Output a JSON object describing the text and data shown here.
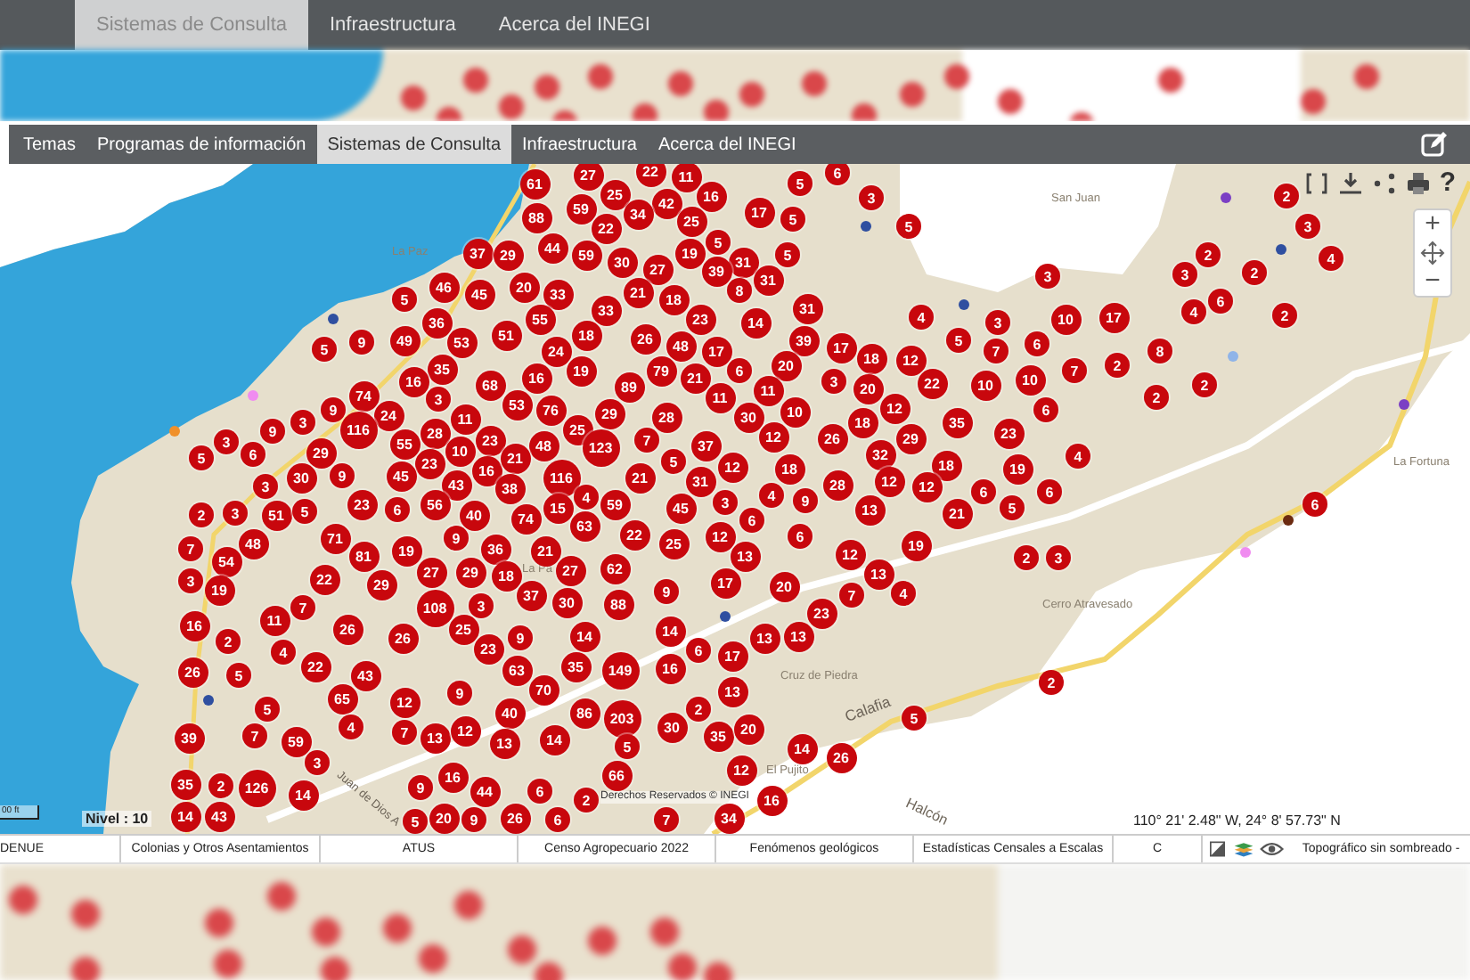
{
  "backdrop": {
    "tabs": [
      {
        "label": "Sistemas de Consulta",
        "selected": true
      },
      {
        "label": "Infraestructura",
        "selected": false
      },
      {
        "label": "Acerca del INEGI",
        "selected": false
      }
    ]
  },
  "nav": {
    "tabs": [
      {
        "label": "Temas",
        "selected": false
      },
      {
        "label": "Programas de información",
        "selected": false
      },
      {
        "label": "Sistemas de Consulta",
        "selected": true
      },
      {
        "label": "Infraestructura",
        "selected": false
      },
      {
        "label": "Acerca del INEGI",
        "selected": false
      }
    ]
  },
  "map": {
    "tools": {
      "help": "?",
      "zoom_in": "+",
      "zoom_out": "−"
    },
    "clusters": [
      "27",
      "22",
      "11",
      "6",
      "61",
      "5",
      "25",
      "42",
      "16",
      "3",
      "2",
      "88",
      "59",
      "22",
      "34",
      "25",
      "17",
      "5",
      "5",
      "3",
      "44",
      "5",
      "37",
      "29",
      "59",
      "30",
      "19",
      "31",
      "5",
      "2",
      "4",
      "27",
      "39",
      "31",
      "3",
      "3",
      "2",
      "5",
      "46",
      "45",
      "20",
      "33",
      "21",
      "18",
      "8",
      "6",
      "36",
      "55",
      "33",
      "23",
      "14",
      "31",
      "4",
      "3",
      "10",
      "17",
      "4",
      "2",
      "5",
      "9",
      "49",
      "53",
      "51",
      "24",
      "18",
      "26",
      "48",
      "17",
      "39",
      "17",
      "18",
      "12",
      "5",
      "7",
      "6",
      "8",
      "35",
      "19",
      "79",
      "6",
      "20",
      "7",
      "2",
      "16",
      "68",
      "16",
      "89",
      "21",
      "11",
      "3",
      "20",
      "22",
      "10",
      "10",
      "2",
      "74",
      "3",
      "11",
      "2",
      "3",
      "9",
      "24",
      "11",
      "53",
      "76",
      "29",
      "28",
      "30",
      "10",
      "18",
      "12",
      "35",
      "6",
      "3",
      "9",
      "116",
      "55",
      "28",
      "23",
      "48",
      "25",
      "123",
      "7",
      "37",
      "12",
      "26",
      "29",
      "23",
      "5",
      "6",
      "29",
      "23",
      "10",
      "16",
      "21",
      "5",
      "12",
      "18",
      "32",
      "18",
      "19",
      "4",
      "3",
      "30",
      "9",
      "45",
      "43",
      "38",
      "116",
      "21",
      "31",
      "28",
      "12",
      "12",
      "6",
      "6",
      "2",
      "3",
      "51",
      "5",
      "23",
      "6",
      "56",
      "40",
      "74",
      "15",
      "4",
      "59",
      "45",
      "3",
      "4",
      "6",
      "9",
      "13",
      "21",
      "5",
      "6",
      "63",
      "7",
      "48",
      "54",
      "71",
      "81",
      "19",
      "9",
      "36",
      "21",
      "22",
      "25",
      "12",
      "13",
      "6",
      "12",
      "19",
      "2",
      "3",
      "3",
      "19",
      "22",
      "29",
      "27",
      "29",
      "18",
      "37",
      "27",
      "62",
      "9",
      "17",
      "20",
      "13",
      "7",
      "4",
      "7",
      "108",
      "3",
      "30",
      "88",
      "11",
      "23",
      "16",
      "26",
      "25",
      "14",
      "2",
      "26",
      "9",
      "14",
      "13",
      "13",
      "4",
      "23",
      "6",
      "17",
      "26",
      "5",
      "22",
      "43",
      "63",
      "35",
      "149",
      "16",
      "2",
      "65",
      "12",
      "9",
      "70",
      "13",
      "5",
      "40",
      "86",
      "203",
      "2",
      "5",
      "39",
      "7",
      "59",
      "4",
      "7",
      "13",
      "12",
      "13",
      "14",
      "5",
      "30",
      "35",
      "20",
      "14",
      "3",
      "26",
      "16",
      "66",
      "12",
      "35",
      "2",
      "126",
      "14",
      "9",
      "44",
      "6",
      "2",
      "16",
      "14",
      "43",
      "5",
      "20",
      "9",
      "26",
      "6",
      "7",
      "34"
    ],
    "points": [
      {
        "color": "#2f4fa0"
      },
      {
        "color": "#2f4fa0"
      },
      {
        "color": "#2f4fa0"
      },
      {
        "color": "#2f4fa0"
      },
      {
        "color": "#7b3fc4"
      },
      {
        "color": "#7b3fc4"
      },
      {
        "color": "#8fb4e8"
      },
      {
        "color": "#f08cf0"
      },
      {
        "color": "#f0902a"
      },
      {
        "color": "#6b2a10"
      },
      {
        "color": "#f08cf0"
      },
      {
        "color": "#2f4fa0"
      },
      {
        "color": "#2f4fa0"
      }
    ],
    "place_labels": [
      "La Paz",
      "San Juan",
      "La Pa",
      "La Fortuna",
      "Cerro Atravesado",
      "Cruz de Piedra",
      "El Pujito"
    ],
    "road_labels": [
      "Juan de Dios A",
      "Calafia",
      "Halcón"
    ],
    "scale": "00 ft",
    "level": "Nivel : 10",
    "attribution": "Derechos Reservados © INEGI",
    "coordinates": "110° 21' 2.48\" W, 24° 8' 57.73\" N"
  },
  "layers": [
    "DENUE",
    "Colonias y Otros Asentamientos",
    "ATUS",
    "Censo Agropecuario 2022",
    "Fenómenos geológicos",
    "Estadísticas Censales a Escalas",
    "C"
  ],
  "basemap": "Topográfico sin sombreado -"
}
